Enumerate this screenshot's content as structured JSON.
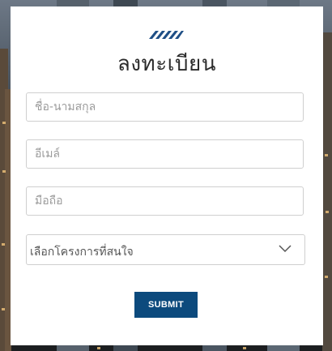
{
  "form": {
    "title": "ลงทะเบียน",
    "logo_icon": "striped-parallelogram-logo",
    "fields": {
      "name_placeholder": "ชื่อ-นามสกุล",
      "email_placeholder": "อีเมล์",
      "phone_placeholder": "มือถือ"
    },
    "project_select": {
      "selected_label": "เลือกโครงการที่สนใจ",
      "icon": "chevron-down-icon"
    },
    "submit_label": "SUBMIT"
  },
  "colors": {
    "submit_bg": "#0c4a7d",
    "logo": "#1f4f86",
    "border": "#cfcfcf"
  }
}
